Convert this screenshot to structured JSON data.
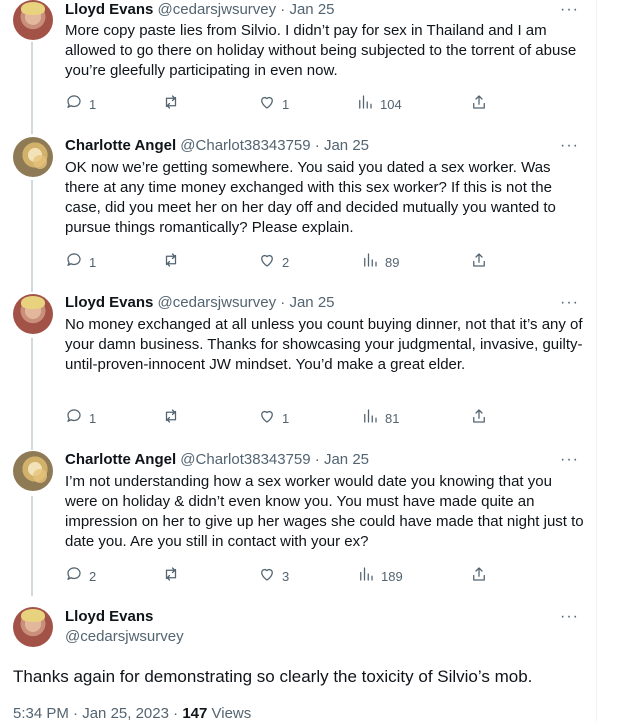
{
  "tweets": [
    {
      "name": "Lloyd Evans",
      "handle": "@cedarsjwsurvey",
      "sep": "·",
      "date": "Jan 25",
      "more": "···",
      "text": "More copy paste lies from Silvio. I didn’t pay for sex in Thailand and I am allowed to go there on holiday without being subjected to the torrent of abuse you’re gleefully participating in even now.",
      "replies": "1",
      "retweets": "",
      "likes": "1",
      "views": "104"
    },
    {
      "name": "Charlotte Angel",
      "handle": "@Charlot38343759",
      "sep": "·",
      "date": "Jan 25",
      "more": "···",
      "text": "OK now we’re getting somewhere.  You said you dated a sex worker.  Was there at any time money exchanged with this sex worker?  If this is not the case, did you meet her on her day off and decided mutually you wanted to pursue things romantically?  Please explain.",
      "replies": "1",
      "retweets": "",
      "likes": "2",
      "views": "89"
    },
    {
      "name": "Lloyd Evans",
      "handle": "@cedarsjwsurvey",
      "sep": "·",
      "date": "Jan 25",
      "more": "···",
      "text": "No money exchanged at all unless you count buying dinner, not that it’s any of your damn business. Thanks for showcasing your judgmental, invasive, guilty-until-proven-innocent JW mindset. You’d make a great elder.",
      "replies": "1",
      "retweets": "",
      "likes": "1",
      "views": "81"
    },
    {
      "name": "Charlotte Angel",
      "handle": "@Charlot38343759",
      "sep": "·",
      "date": "Jan 25",
      "more": "···",
      "text": "I’m not understanding how a sex worker would date you knowing that you were on holiday & didn’t even know you. You must have made quite an impression on her to give up her wages she could have made that night just to date you. Are you still in contact with your ex?",
      "replies": "2",
      "retweets": "",
      "likes": "3",
      "views": "189"
    }
  ],
  "main_tweet": {
    "name": "Lloyd Evans",
    "handle": "@cedarsjwsurvey",
    "more": "···",
    "text": "Thanks again for demonstrating so clearly the toxicity of Silvio’s mob.",
    "time": "5:34 PM",
    "date": "Jan 25, 2023",
    "sep": "·",
    "views_count": "147",
    "views_label": "Views"
  },
  "icons": {
    "reply": "reply-icon",
    "retweet": "retweet-icon",
    "like": "heart-icon",
    "views": "views-chart-icon",
    "share": "share-icon",
    "more": "more-dots-icon"
  },
  "colors": {
    "text": "#0f1419",
    "muted": "#536471",
    "thread_line": "#cfd9de"
  }
}
